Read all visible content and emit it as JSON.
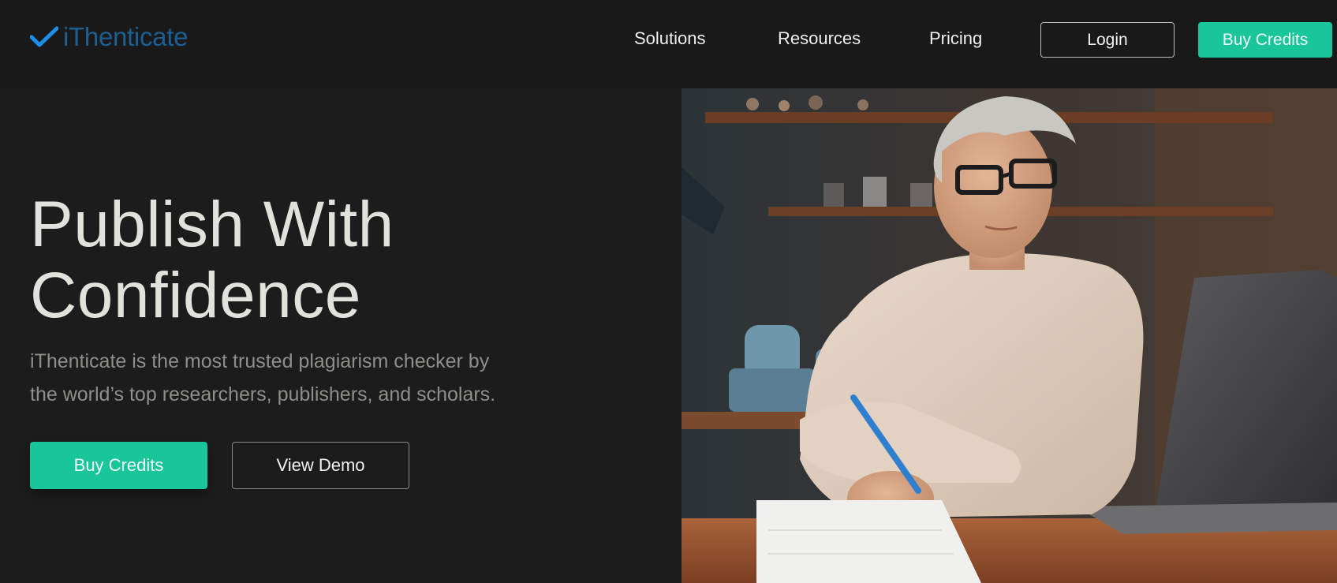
{
  "header": {
    "logo_text": "iThenticate",
    "nav": [
      {
        "label": "Solutions"
      },
      {
        "label": "Resources"
      },
      {
        "label": "Pricing"
      }
    ],
    "login_label": "Login",
    "buy_label": "Buy Credits"
  },
  "hero": {
    "title_line1": "Publish With",
    "title_line2": "Confidence",
    "subtitle_line1": "iThenticate is the most trusted plagiarism checker by",
    "subtitle_line2": "the world’s top researchers, publishers, and scholars.",
    "buy_label": "Buy Credits",
    "demo_label": "View Demo"
  },
  "colors": {
    "accent": "#18c699",
    "logo": "#1b5f93",
    "background": "#1c1c1c"
  },
  "icons": {
    "logo": "checkmark-icon"
  }
}
